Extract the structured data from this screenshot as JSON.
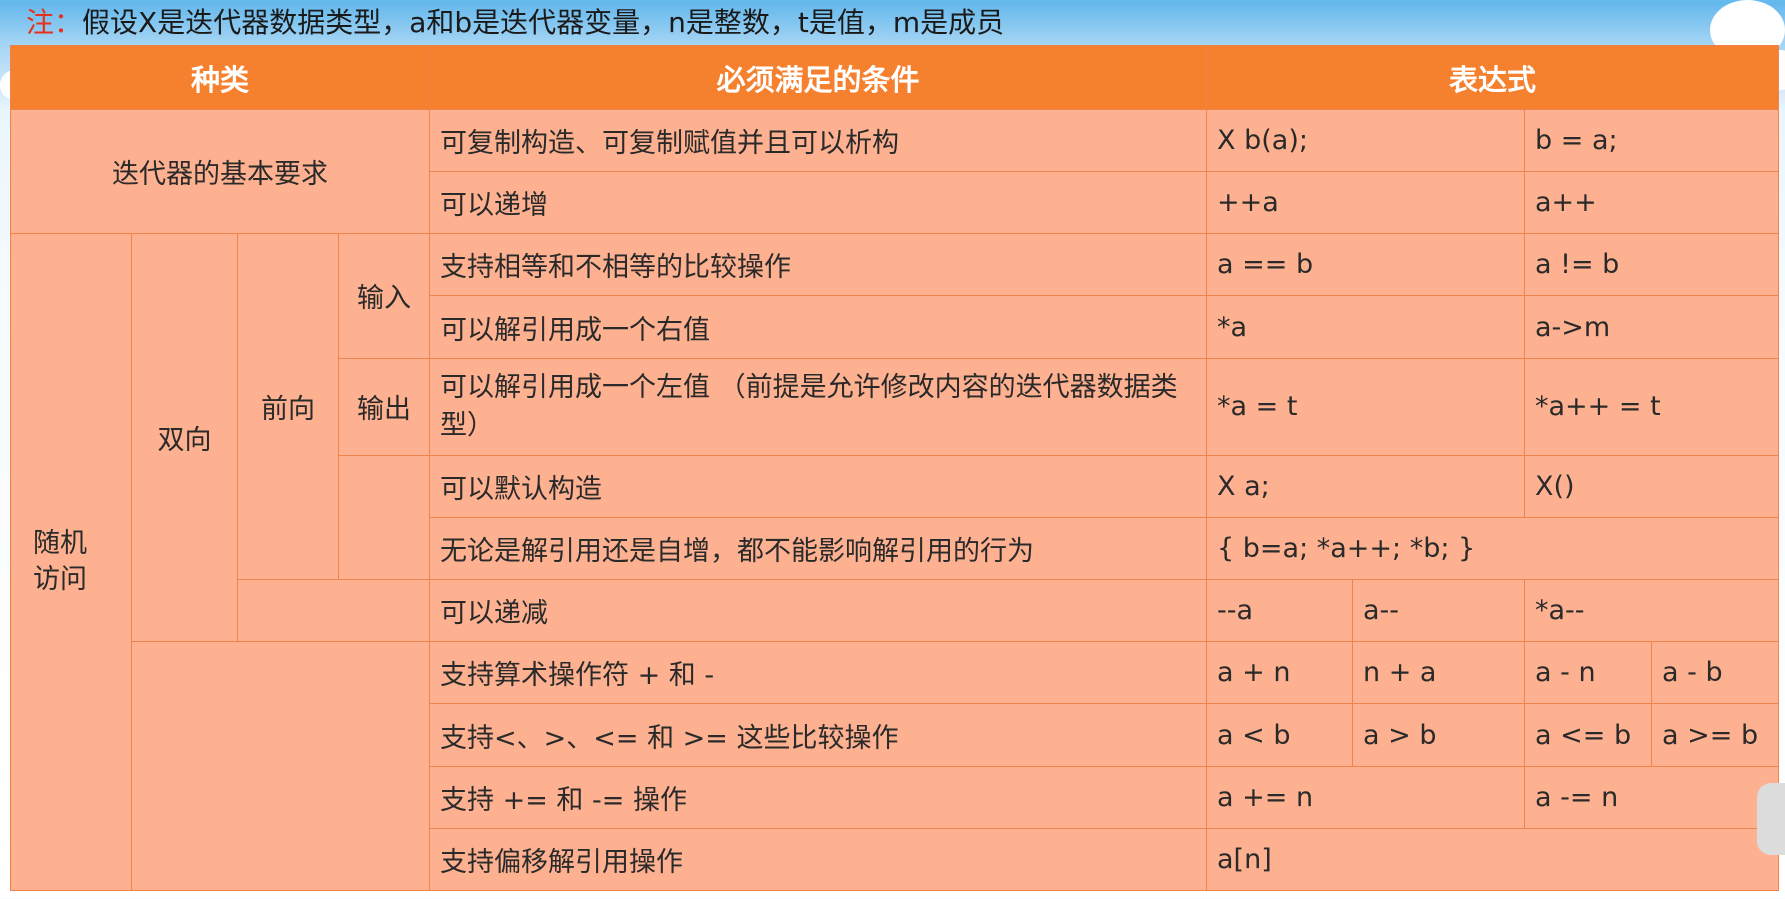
{
  "note": {
    "prefix": "注：",
    "text": "假设X是迭代器数据类型，a和b是迭代器变量，n是整数，t是值，m是成员"
  },
  "headers": {
    "kind": "种类",
    "condition": "必须满足的条件",
    "expression": "表达式"
  },
  "categories": {
    "basic": "迭代器的基本要求",
    "random": "随机\n访问",
    "bidirectional": "双向",
    "forward": "前向",
    "input": "输入",
    "output": "输出"
  },
  "rows": [
    {
      "cond": "可复制构造、可复制赋值并且可以析构",
      "e1": "X b(a);",
      "e2": "b = a;"
    },
    {
      "cond": "可以递增",
      "e1": "++a",
      "e2": "a++"
    },
    {
      "cond": "支持相等和不相等的比较操作",
      "e1": "a == b",
      "e2": "a != b"
    },
    {
      "cond": "可以解引用成一个右值",
      "e1": "*a",
      "e2": "a->m"
    },
    {
      "cond": "可以解引用成一个左值\n（前提是允许修改内容的迭代器数据类型）",
      "e1": "*a = t",
      "e2": "*a++ = t"
    },
    {
      "cond": "可以默认构造",
      "e1": "X a;",
      "e2": "X()"
    },
    {
      "cond": "无论是解引用还是自增，都不能影响解引用的行为",
      "e1": "{ b=a; *a++; *b; }"
    },
    {
      "cond": "可以递减",
      "e1": "--a",
      "e2": "a--",
      "e3": "*a--"
    },
    {
      "cond": "支持算术操作符 + 和 -",
      "e1": "a + n",
      "e2": "n + a",
      "e3": "a - n",
      "e4": "a - b"
    },
    {
      "cond": "支持<、>、<= 和 >= 这些比较操作",
      "e1": "a < b",
      "e2": "a > b",
      "e3": "a <= b",
      "e4": "a >= b"
    },
    {
      "cond": "支持 += 和 -= 操作",
      "e1": "a += n",
      "e2": "a -= n"
    },
    {
      "cond": "支持偏移解引用操作",
      "e1": "a[n]"
    }
  ],
  "colors": {
    "header_bg": "#f5802e",
    "cell_bg": "#fdb190",
    "border": "#f0834a",
    "note_prefix": "#e8311c"
  }
}
